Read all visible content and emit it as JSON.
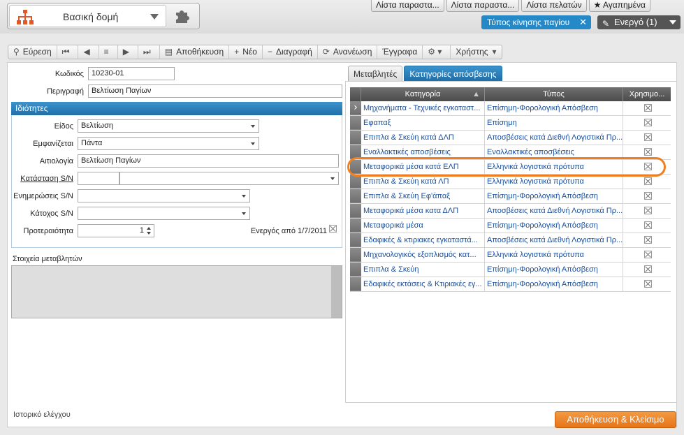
{
  "app": {
    "title": "Βασική δομή",
    "logo_icon": "org-chart-icon",
    "modules_icon": "puzzle-icon"
  },
  "top_tabs": [
    "Λίστα παραστα...",
    "Λίστα παραστα...",
    "Λίστα πελατών",
    "★ Αγαπημένα"
  ],
  "filter_chip": {
    "label": "Τύπος κίνησης παγίου",
    "close": "✕"
  },
  "state_button": {
    "label": "Ενεργό (1)"
  },
  "toolbar": {
    "search": "Εύρεση",
    "save": "Αποθήκευση",
    "new": "Νέο",
    "delete": "Διαγραφή",
    "refresh": "Ανανέωση",
    "documents": "Έγγραφα",
    "user": "Χρήστης"
  },
  "form": {
    "code_label": "Κωδικός",
    "code_value": "10230-01",
    "description_label": "Περιγραφή",
    "description_value": "Βελτίωση Παγίων",
    "properties_header": "Ιδιότητες",
    "type_label": "Είδος",
    "type_value": "Βελτίωση",
    "display_label": "Εμφανίζεται",
    "display_value": "Πάντα",
    "reason_label": "Αιτιολογία",
    "reason_value": "Βελτίωση Παγίων",
    "sn_status_label": "Κατάσταση S/N",
    "sn_updates_label": "Ενημερώσεις S/N",
    "sn_holder_label": "Κάτοχος S/N",
    "priority_label": "Προτεραιότητα",
    "priority_value": "1",
    "active_from_label": "Ενεργός από 1/7/2011",
    "variables_label": "Στοιχεία μεταβλητών"
  },
  "right_tabs": [
    "Μεταβλητές",
    "Κατηγορίες απόσβεσης"
  ],
  "grid": {
    "columns": [
      "Κατηγορία",
      "Τύπος",
      "Χρησιμο..."
    ],
    "rows": [
      [
        "Μηχανήματα - Τεχνικές εγκαταστ...",
        "Επίσημη-Φορολογική Απόσβεση"
      ],
      [
        "Εφαπαξ",
        "Επίσημη"
      ],
      [
        "Επιπλα & Σκεύη κατά ΔΛΠ",
        "Αποσβέσεις κατά Διεθνή Λογιστικά Πρ..."
      ],
      [
        "Εναλλακτικές αποσβέσεις",
        "Εναλλακτικές αποσβέσεις"
      ],
      [
        "Μεταφορικά μέσα κατά ΕΛΠ",
        "Ελληνικά λογιστικά πρότυπα"
      ],
      [
        "Επιπλα & Σκεύη κατά ΛΠ",
        "Ελληνικά λογιστικά πρότυπα"
      ],
      [
        "Επιπλα & Σκεύη Εφ'άπαξ",
        "Επίσημη-Φορολογική Απόσβεση"
      ],
      [
        "Μεταφορικά μέσα κατα ΔΛΠ",
        "Αποσβέσεις κατά Διεθνή Λογιστικά Πρ..."
      ],
      [
        "Μεταφορικά μέσα",
        "Επίσημη-Φορολογική Απόσβεση"
      ],
      [
        "Εδαφικές & κτιριακες εγκαταστά...",
        "Αποσβέσεις κατά Διεθνή Λογιστικά Πρ..."
      ],
      [
        "Μηχανολογικός εξοπλισμός κατ...",
        "Ελληνικά λογιστικά πρότυπα"
      ],
      [
        "Επιπλα & Σκεύη",
        "Επίσημη-Φορολογική Απόσβεση"
      ],
      [
        "Εδαφικές εκτάσεις & Κτιριακές εγ...",
        "Επίσημη-Φορολογική Απόσβεση"
      ]
    ]
  },
  "footer": {
    "history_link": "Ιστορικό ελέγχου",
    "save_close": "Αποθήκευση & Κλείσιμο"
  }
}
